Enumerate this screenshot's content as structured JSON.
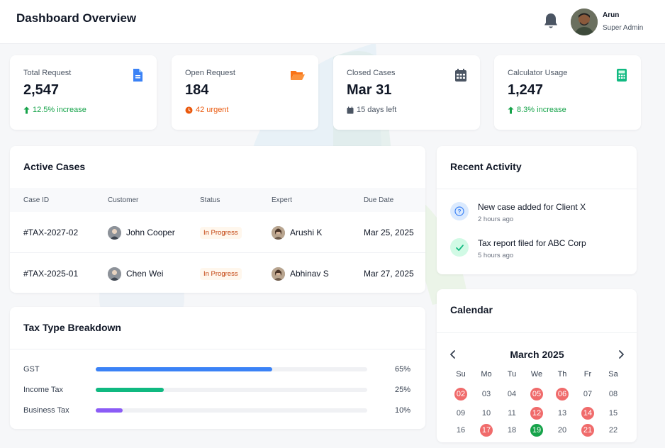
{
  "header": {
    "title": "Dashboard Overview",
    "user_name": "Arun",
    "user_role": "Super Admin",
    "notification_icon": "bell-icon"
  },
  "stats": [
    {
      "label": "Total Request",
      "value": "2,547",
      "sub": "12.5% increase",
      "sub_icon": "arrow-up-icon",
      "icon": "document-icon",
      "color": "#3b82f6",
      "sub_color": "#16a34a"
    },
    {
      "label": "Open Request",
      "value": "184",
      "sub": "42 urgent",
      "sub_icon": "clock-icon",
      "icon": "folder-open-icon",
      "color": "#f97316",
      "sub_color": "#ea580c"
    },
    {
      "label": "Closed Cases",
      "value": "Mar 31",
      "sub": "15 days left",
      "sub_icon": "calendar-icon",
      "icon": "calendar-icon",
      "color": "#4b5563",
      "sub_color": "#4b5563"
    },
    {
      "label": "Calculator Usage",
      "value": "1,247",
      "sub": "8.3% increase",
      "sub_icon": "arrow-up-icon",
      "icon": "calculator-icon",
      "color": "#10b981",
      "sub_color": "#16a34a"
    }
  ],
  "active_cases": {
    "title": "Active Cases",
    "columns": [
      "Case ID",
      "Customer",
      "Status",
      "Expert",
      "Due Date"
    ],
    "rows": [
      {
        "case_id": "#TAX-2027-02",
        "customer": "John Cooper",
        "status": "In Progress",
        "expert": "Arushi K",
        "due": "Mar 25, 2025"
      },
      {
        "case_id": "#TAX-2025-01",
        "customer": "Chen Wei",
        "status": "In Progress",
        "expert": "Abhinav S",
        "due": "Mar 27, 2025"
      }
    ]
  },
  "tax_breakdown": {
    "title": "Tax Type Breakdown",
    "items": [
      {
        "label": "GST",
        "percent": "65%",
        "value": 65,
        "color": "#3b82f6"
      },
      {
        "label": "Income Tax",
        "percent": "25%",
        "value": 25,
        "color": "#10b981"
      },
      {
        "label": "Business Tax",
        "percent": "10%",
        "value": 10,
        "color": "#8b5cf6"
      }
    ]
  },
  "recent_activity": {
    "title": "Recent Activity",
    "items": [
      {
        "text": "New case added for Client X",
        "time": "2 hours ago",
        "icon": "question-icon",
        "bg": "#dbeafe",
        "color": "#3b82f6"
      },
      {
        "text": "Tax report filed for ABC Corp",
        "time": "5 hours ago",
        "icon": "check-icon",
        "bg": "#d1fae5",
        "color": "#10b981"
      }
    ]
  },
  "calendar": {
    "title": "Calendar",
    "month": "March 2025",
    "weekdays": [
      "Su",
      "Mo",
      "Tu",
      "We",
      "Th",
      "Fr",
      "Sa"
    ],
    "weeks": [
      [
        {
          "d": "02",
          "s": "red"
        },
        {
          "d": "03"
        },
        {
          "d": "04"
        },
        {
          "d": "05",
          "s": "red"
        },
        {
          "d": "06",
          "s": "red"
        },
        {
          "d": "07"
        },
        {
          "d": "08"
        }
      ],
      [
        {
          "d": "09"
        },
        {
          "d": "10"
        },
        {
          "d": "11"
        },
        {
          "d": "12",
          "s": "red"
        },
        {
          "d": "13"
        },
        {
          "d": "14",
          "s": "red"
        },
        {
          "d": "15"
        }
      ],
      [
        {
          "d": "16"
        },
        {
          "d": "17",
          "s": "red"
        },
        {
          "d": "18"
        },
        {
          "d": "19",
          "s": "green"
        },
        {
          "d": "20"
        },
        {
          "d": "21",
          "s": "red"
        },
        {
          "d": "22"
        }
      ]
    ]
  }
}
